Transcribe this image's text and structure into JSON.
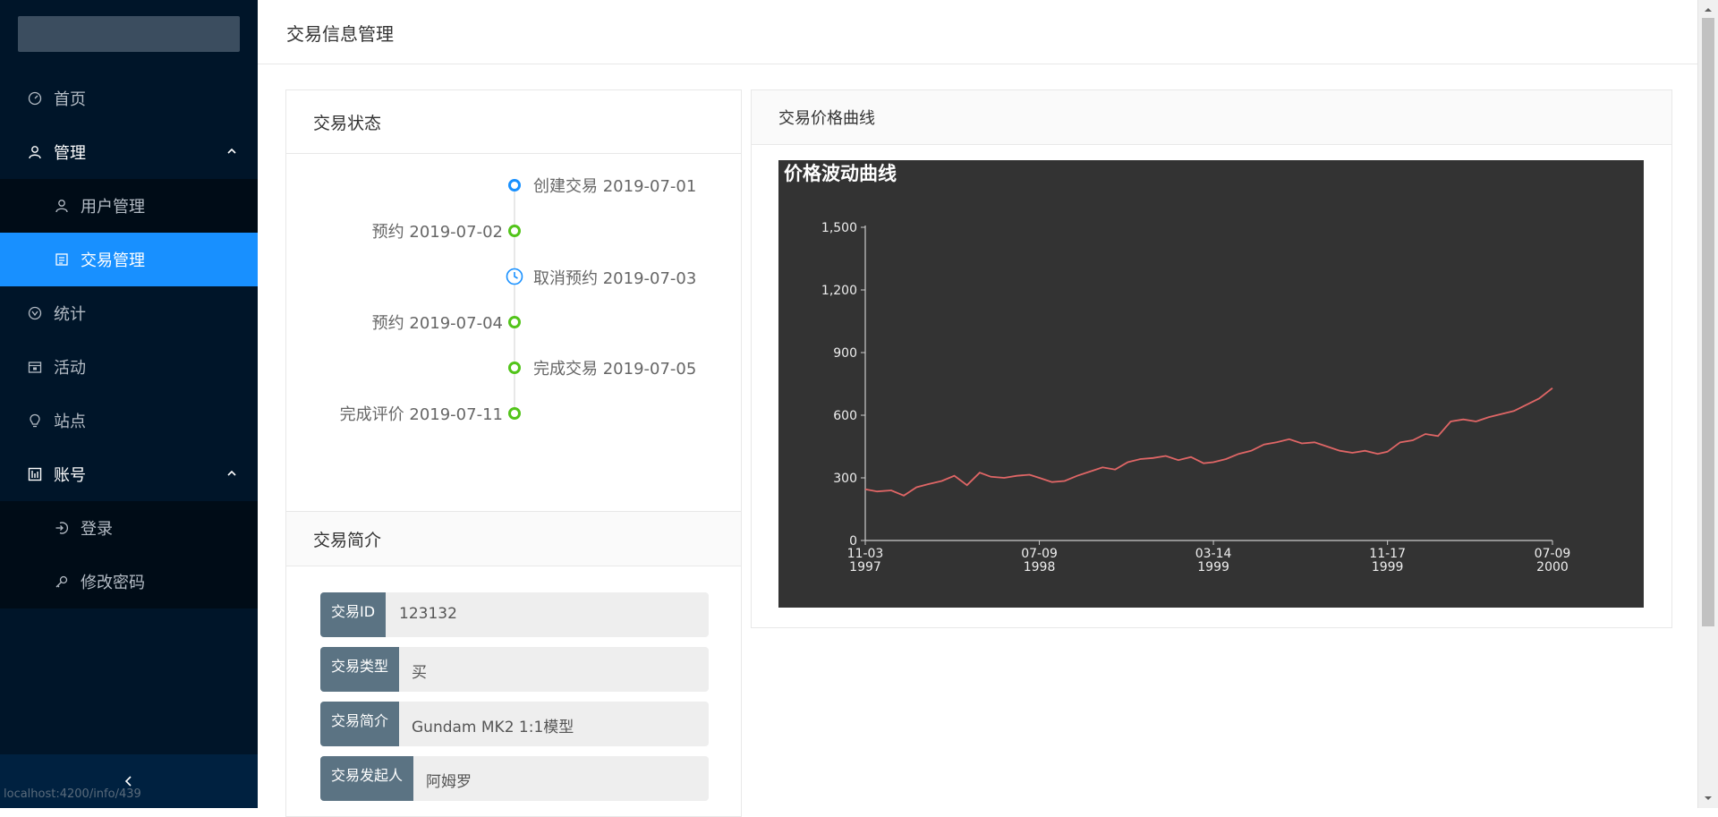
{
  "sidebar": {
    "items": [
      {
        "label": "首页",
        "icon": "dashboard-icon"
      },
      {
        "label": "管理",
        "icon": "user-icon",
        "open": true
      },
      {
        "label": "用户管理",
        "icon": "user-icon",
        "sub": true
      },
      {
        "label": "交易管理",
        "icon": "profile-icon",
        "sub": true,
        "selected": true
      },
      {
        "label": "统计",
        "icon": "statistics-icon"
      },
      {
        "label": "活动",
        "icon": "calendar-icon"
      },
      {
        "label": "站点",
        "icon": "bulb-icon"
      },
      {
        "label": "账号",
        "icon": "account-book-icon",
        "open": true
      },
      {
        "label": "登录",
        "icon": "login-icon",
        "sub": true
      },
      {
        "label": "修改密码",
        "icon": "key-icon",
        "sub": true
      }
    ],
    "collapse_icon": "chevron-left-icon"
  },
  "status_bar": {
    "url": "localhost:4200/info/439"
  },
  "header": {
    "title": "交易信息管理"
  },
  "status_card": {
    "title": "交易状态",
    "events": [
      {
        "text": "创建交易 2019-07-01",
        "side": "right",
        "dot": "blue"
      },
      {
        "text": "预约 2019-07-02",
        "side": "left",
        "dot": "green"
      },
      {
        "text": "取消预约 2019-07-03",
        "side": "right",
        "dot": "clock"
      },
      {
        "text": "预约 2019-07-04",
        "side": "left",
        "dot": "green"
      },
      {
        "text": "完成交易 2019-07-05",
        "side": "right",
        "dot": "green"
      },
      {
        "text": "完成评价 2019-07-11",
        "side": "left",
        "dot": "green"
      }
    ]
  },
  "intro_card": {
    "title": "交易简介",
    "fields": [
      {
        "label": "交易ID",
        "value": "123132"
      },
      {
        "label": "交易类型",
        "value": "买"
      },
      {
        "label": "交易简介",
        "value": "Gundam MK2 1:1模型"
      },
      {
        "label": "交易发起人",
        "value": "阿姆罗"
      }
    ]
  },
  "chart_card": {
    "title": "交易价格曲线"
  },
  "colors": {
    "sidebar_bg": "#001529",
    "accent": "#1890ff",
    "chart_bg": "#333333",
    "line": "#e06666",
    "success": "#52c41a"
  },
  "chart_data": {
    "type": "line",
    "title": "价格波动曲线",
    "xlabel": "",
    "ylabel": "",
    "ylim": [
      0,
      1500
    ],
    "y_ticks": [
      0,
      300,
      600,
      900,
      1200,
      1500
    ],
    "y_tick_labels": [
      "0",
      "300",
      "600",
      "900",
      "1,200",
      "1,500"
    ],
    "x_ticks": [
      {
        "date": "1997-11-03",
        "label": [
          "11-03",
          "1997"
        ]
      },
      {
        "date": "1998-07-09",
        "label": [
          "07-09",
          "1998"
        ]
      },
      {
        "date": "1999-03-14",
        "label": [
          "03-14",
          "1999"
        ]
      },
      {
        "date": "1999-11-17",
        "label": [
          "11-17",
          "1999"
        ]
      },
      {
        "date": "2000-07-09",
        "label": [
          "07-09",
          "2000"
        ]
      }
    ],
    "series": [
      {
        "color": "#e06666",
        "x": [
          "1997-11-03",
          "1997-11-20",
          "1997-12-10",
          "1997-12-28",
          "1998-01-15",
          "1998-02-01",
          "1998-02-20",
          "1998-03-10",
          "1998-03-28",
          "1998-04-15",
          "1998-05-01",
          "1998-05-20",
          "1998-06-07",
          "1998-06-25",
          "1998-07-09",
          "1998-07-27",
          "1998-08-14",
          "1998-09-01",
          "1998-09-19",
          "1998-10-07",
          "1998-10-25",
          "1998-11-12",
          "1998-11-30",
          "1998-12-18",
          "1999-01-05",
          "1999-01-23",
          "1999-02-10",
          "1999-02-28",
          "1999-03-14",
          "1999-04-01",
          "1999-04-19",
          "1999-05-07",
          "1999-05-25",
          "1999-06-12",
          "1999-06-30",
          "1999-07-18",
          "1999-08-05",
          "1999-08-23",
          "1999-09-10",
          "1999-09-28",
          "1999-10-16",
          "1999-11-03",
          "1999-11-17",
          "1999-12-05",
          "1999-12-23",
          "2000-01-10",
          "2000-01-28",
          "2000-02-15",
          "2000-03-04",
          "2000-03-22",
          "2000-04-09",
          "2000-04-27",
          "2000-05-15",
          "2000-06-02",
          "2000-06-20",
          "2000-07-09"
        ],
        "values": [
          245,
          235,
          240,
          215,
          255,
          270,
          285,
          310,
          265,
          325,
          305,
          300,
          310,
          315,
          300,
          280,
          285,
          310,
          330,
          350,
          340,
          375,
          390,
          395,
          405,
          385,
          400,
          370,
          375,
          390,
          415,
          430,
          460,
          470,
          485,
          465,
          470,
          450,
          430,
          420,
          430,
          415,
          425,
          470,
          480,
          510,
          500,
          570,
          580,
          570,
          590,
          605,
          620,
          650,
          680,
          730
        ]
      }
    ]
  }
}
